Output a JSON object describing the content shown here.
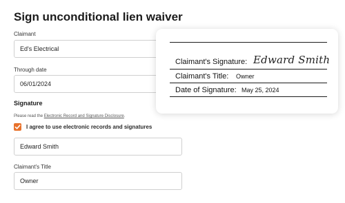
{
  "page": {
    "title": "Sign unconditional lien waiver"
  },
  "form": {
    "claimant": {
      "label": "Claimant",
      "value": "Ed's Electrical"
    },
    "through_date": {
      "label": "Through date",
      "value": "06/01/2024"
    },
    "signature_section": {
      "heading": "Signature",
      "disclosure_prefix": "Please read the ",
      "disclosure_link": "Electronic Record and Signature Disclosure",
      "disclosure_suffix": ".",
      "agree_checked": true,
      "agree_label": "I agree to use electronic records and signatures",
      "signer_name": "Edward Smith"
    },
    "claimant_title": {
      "label": "Claimant's Title",
      "value": "Owner"
    }
  },
  "signature_preview": {
    "signature_label": "Claimant's Signature:",
    "signature_script": "Edward Smith",
    "title_label": "Claimant's Title:",
    "title_value": "Owner",
    "date_label": "Date of Signature:",
    "date_value": "May 25, 2024"
  },
  "colors": {
    "accent": "#e8722c"
  },
  "icons": {
    "checkbox_checked": "check-icon"
  }
}
